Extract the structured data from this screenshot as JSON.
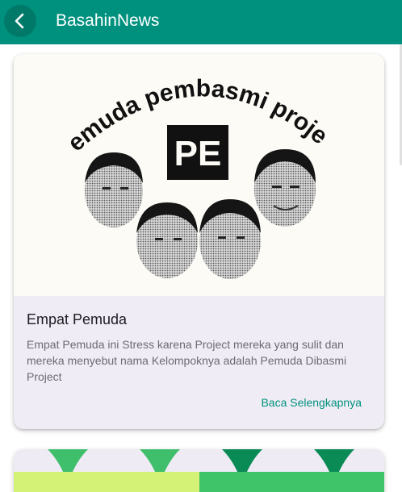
{
  "appbar": {
    "title": "BasahinNews",
    "back_icon": "arrow-back-icon",
    "color": "#00917e"
  },
  "news": [
    {
      "image_caption": "pemuda pembasmi projek",
      "logo_text": "PE",
      "title": "Empat Pemuda",
      "description": "Empat Pemuda ini Stress karena Project mereka yang sulit dan mereka menyebut nama Kelompoknya adalah Pemuda Dibasmi Project",
      "read_more_label": "Baca Selengkapnya"
    }
  ],
  "colors": {
    "accent": "#00917e",
    "card_background": "#efecf5",
    "lime": "#d4f276",
    "green": "#40c46a"
  }
}
